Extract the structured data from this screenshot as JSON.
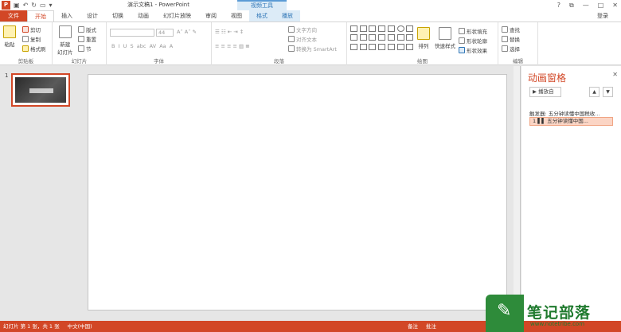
{
  "window": {
    "title": "演示文稿1 - PowerPoint",
    "context_tools": "视频工具",
    "controls": [
      "?",
      "⧉",
      "—",
      "□",
      "✕"
    ]
  },
  "tabs": [
    "文件",
    "开始",
    "插入",
    "设计",
    "切换",
    "动画",
    "幻灯片放映",
    "审阅",
    "视图",
    "格式",
    "播放"
  ],
  "login": "登录",
  "ribbon": {
    "clipboard": {
      "paste": "粘贴",
      "cut": "剪切",
      "copy": "复制",
      "format_painter": "格式刷",
      "label": "剪贴板"
    },
    "slides": {
      "new_slide": "新建\n幻灯片",
      "layout": "版式",
      "reset": "重置",
      "section": "节",
      "label": "幻灯片"
    },
    "font": {
      "size": "44",
      "label": "字体"
    },
    "paragraph": {
      "text_direction": "文字方向",
      "align_text": "对齐文本",
      "convert_smartart": "转换为 SmartArt",
      "label": "段落"
    },
    "drawing": {
      "arrange": "排列",
      "quick_styles": "快速样式",
      "shape_fill": "形状填充",
      "shape_outline": "形状轮廓",
      "shape_effects": "形状效果",
      "label": "绘图"
    },
    "editing": {
      "find": "查找",
      "replace": "替换",
      "select": "选择",
      "label": "编辑"
    }
  },
  "thumbnails": {
    "number": "1"
  },
  "anim_pane": {
    "title": "动画窗格",
    "close": "✕",
    "play_from": "播放自",
    "trigger": "触发器: 五分钟读懂中国税收...",
    "item": "1 ▌▌ 五分钟读懂中国..."
  },
  "status": {
    "slide_info": "幻灯片 第 1 张，共 1 张",
    "language": "中文(中国)",
    "notes": "备注",
    "comments": "批注"
  },
  "watermark": {
    "text": "笔记部落",
    "url": "www.notetribe.com"
  }
}
